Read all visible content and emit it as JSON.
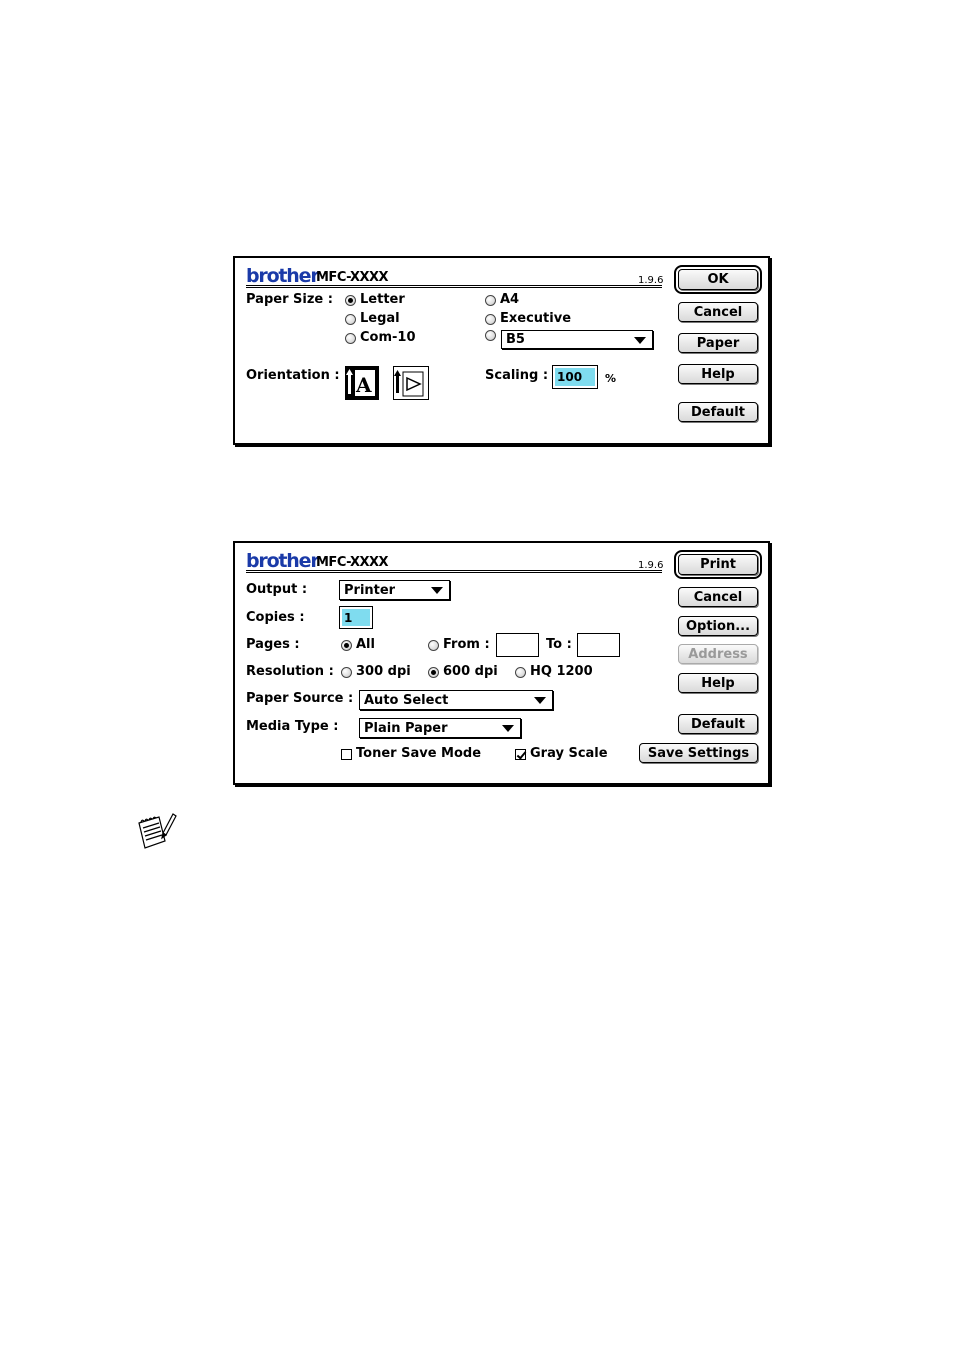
{
  "page_setup": {
    "brand": "brother",
    "model": "MFC-XXXX",
    "version": "1.9.6",
    "paper_size_label": "Paper Size :",
    "paper_sizes": [
      "Letter",
      "Legal",
      "Com-10",
      "A4",
      "Executive"
    ],
    "selected_paper_size": "Letter",
    "other_size_value": "B5",
    "orientation_label": "Orientation :",
    "orientation_selected": "portrait",
    "scaling_label": "Scaling :",
    "scaling_value": "100",
    "scaling_unit": "%",
    "buttons": {
      "ok": "OK",
      "cancel": "Cancel",
      "paper": "Paper",
      "help": "Help",
      "default": "Default"
    }
  },
  "print": {
    "brand": "brother",
    "model": "MFC-XXXX",
    "version": "1.9.6",
    "output_label": "Output :",
    "output_value": "Printer",
    "copies_label": "Copies :",
    "copies_value": "1",
    "pages_label": "Pages :",
    "pages_all": "All",
    "pages_from": "From :",
    "pages_to": "To :",
    "from_value": "",
    "to_value": "",
    "resolution_label": "Resolution :",
    "resolutions": [
      "300 dpi",
      "600 dpi",
      "HQ 1200"
    ],
    "selected_resolution": "600 dpi",
    "paper_source_label": "Paper Source :",
    "paper_source_value": "Auto Select",
    "media_type_label": "Media Type :",
    "media_type_value": "Plain Paper",
    "toner_save_label": "Toner Save Mode",
    "toner_save_checked": false,
    "gray_scale_label": "Gray Scale",
    "gray_scale_checked": true,
    "buttons": {
      "print": "Print",
      "cancel": "Cancel",
      "option": "Option...",
      "address": "Address",
      "help": "Help",
      "default": "Default",
      "save_settings": "Save Settings"
    }
  },
  "colors": {
    "brand_blue": "#1a3aa8",
    "field_highlight": "#7fdcef"
  },
  "icons": [
    "portrait-orientation-icon",
    "landscape-orientation-icon",
    "note-pad-icon"
  ]
}
